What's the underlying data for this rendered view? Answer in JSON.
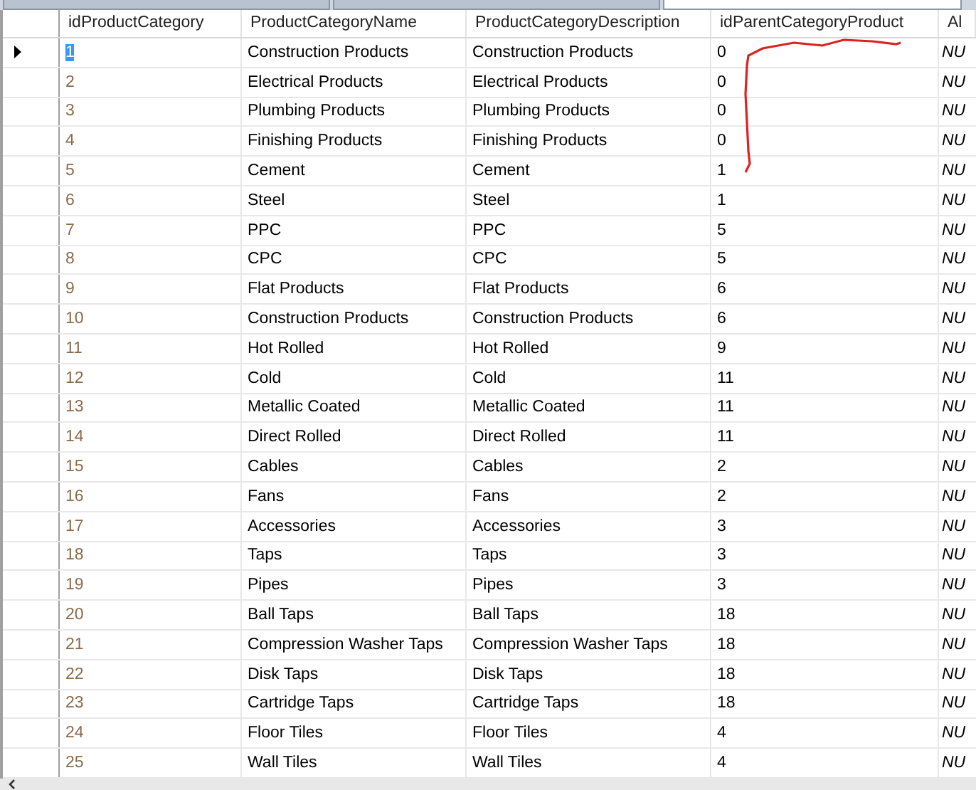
{
  "tabs": [
    {
      "selected": false
    },
    {
      "selected": false
    },
    {
      "selected": true
    }
  ],
  "table": {
    "columns": [
      "idProductCategory",
      "ProductCategoryName",
      "ProductCategoryDescription",
      "idParentCategoryProduct",
      "Al"
    ],
    "rows": [
      {
        "selected": true,
        "cells": [
          "1",
          "Construction Products",
          "Construction Products",
          "0",
          "NU"
        ]
      },
      {
        "selected": false,
        "cells": [
          "2",
          "Electrical Products",
          "Electrical Products",
          "0",
          "NU"
        ]
      },
      {
        "selected": false,
        "cells": [
          "3",
          "Plumbing Products",
          "Plumbing Products",
          "0",
          "NU"
        ]
      },
      {
        "selected": false,
        "cells": [
          "4",
          "Finishing Products",
          "Finishing Products",
          "0",
          "NU"
        ]
      },
      {
        "selected": false,
        "cells": [
          "5",
          "Cement",
          "Cement",
          "1",
          "NU"
        ]
      },
      {
        "selected": false,
        "cells": [
          "6",
          "Steel",
          "Steel",
          "1",
          "NU"
        ]
      },
      {
        "selected": false,
        "cells": [
          "7",
          "PPC",
          "PPC",
          "5",
          "NU"
        ]
      },
      {
        "selected": false,
        "cells": [
          "8",
          "CPC",
          "CPC",
          "5",
          "NU"
        ]
      },
      {
        "selected": false,
        "cells": [
          "9",
          "Flat Products",
          "Flat Products",
          "6",
          "NU"
        ]
      },
      {
        "selected": false,
        "cells": [
          "10",
          "Construction Products",
          "Construction Products",
          "6",
          "NU"
        ]
      },
      {
        "selected": false,
        "cells": [
          "11",
          "Hot Rolled",
          "Hot Rolled",
          "9",
          "NU"
        ]
      },
      {
        "selected": false,
        "cells": [
          "12",
          "Cold",
          "Cold",
          "11",
          "NU"
        ]
      },
      {
        "selected": false,
        "cells": [
          "13",
          "Metallic Coated",
          "Metallic Coated",
          "11",
          "NU"
        ]
      },
      {
        "selected": false,
        "cells": [
          "14",
          "Direct Rolled",
          "Direct Rolled",
          "11",
          "NU"
        ]
      },
      {
        "selected": false,
        "cells": [
          "15",
          "Cables",
          "Cables",
          "2",
          "NU"
        ]
      },
      {
        "selected": false,
        "cells": [
          "16",
          "Fans",
          "Fans",
          "2",
          "NU"
        ]
      },
      {
        "selected": false,
        "cells": [
          "17",
          "Accessories",
          "Accessories",
          "3",
          "NU"
        ]
      },
      {
        "selected": false,
        "cells": [
          "18",
          "Taps",
          "Taps",
          "3",
          "NU"
        ]
      },
      {
        "selected": false,
        "cells": [
          "19",
          "Pipes",
          "Pipes",
          "3",
          "NU"
        ]
      },
      {
        "selected": false,
        "cells": [
          "20",
          "Ball Taps",
          "Ball Taps",
          "18",
          "NU"
        ]
      },
      {
        "selected": false,
        "cells": [
          "21",
          "Compression Washer Taps",
          "Compression Washer Taps",
          "18",
          "NU"
        ]
      },
      {
        "selected": false,
        "cells": [
          "22",
          "Disk Taps",
          "Disk Taps",
          "18",
          "NU"
        ]
      },
      {
        "selected": false,
        "cells": [
          "23",
          "Cartridge Taps",
          "Cartridge Taps",
          "18",
          "NU"
        ]
      },
      {
        "selected": false,
        "cells": [
          "24",
          "Floor Tiles",
          "Floor Tiles",
          "4",
          "NU"
        ]
      },
      {
        "selected": false,
        "cells": [
          "25",
          "Wall Tiles",
          "Wall Tiles",
          "4",
          "NU"
        ]
      }
    ]
  }
}
